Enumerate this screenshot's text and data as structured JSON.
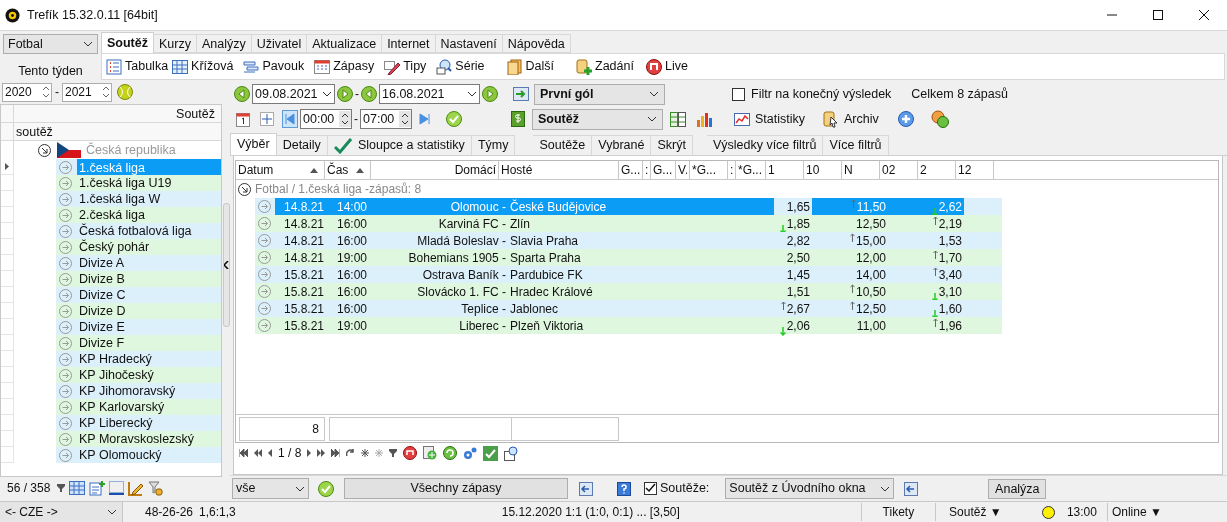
{
  "window": {
    "title": "Trefík 15.32.0.11 [64bit]"
  },
  "sport_select": {
    "value": "Fotbal"
  },
  "menu_tabs": [
    {
      "label": "Soutěž",
      "selected": true
    },
    {
      "label": "Kurzy",
      "selected": false
    },
    {
      "label": "Analýzy",
      "selected": false
    },
    {
      "label": "Uživatel",
      "selected": false
    },
    {
      "label": "Aktualizace",
      "selected": false
    },
    {
      "label": "Internet",
      "selected": false
    },
    {
      "label": "Nastavení",
      "selected": false
    },
    {
      "label": "Nápověda",
      "selected": false
    }
  ],
  "toolbar": [
    "Tabulka",
    "Křížová",
    "Pavouk",
    "Zápasy",
    "Tipy",
    "Série",
    "Další",
    "Zadání",
    "Live"
  ],
  "left_panel": {
    "period": "Tento týden",
    "year_from": "2020",
    "year_separator": "-",
    "year_to": "2021",
    "column_header": "Soutěž",
    "filter": "soutěž",
    "country": {
      "label": "Česká republika",
      "expanded": true
    },
    "items": [
      {
        "label": "1.česká liga",
        "selected": true
      },
      {
        "label": "1.česká liga U19",
        "selected": false
      },
      {
        "label": "1.česká liga W",
        "selected": false
      },
      {
        "label": "2.česká liga",
        "selected": false
      },
      {
        "label": "Česká fotbalová liga",
        "selected": false
      },
      {
        "label": "Český pohár",
        "selected": false
      },
      {
        "label": "Divize A",
        "selected": false
      },
      {
        "label": "Divize B",
        "selected": false
      },
      {
        "label": "Divize C",
        "selected": false
      },
      {
        "label": "Divize D",
        "selected": false
      },
      {
        "label": "Divize E",
        "selected": false
      },
      {
        "label": "Divize F",
        "selected": false
      },
      {
        "label": "KP Hradecký",
        "selected": false
      },
      {
        "label": "KP Jihočeský",
        "selected": false
      },
      {
        "label": "KP Jihomoravský",
        "selected": false
      },
      {
        "label": "KP Karlovarský",
        "selected": false
      },
      {
        "label": "KP Liberecký",
        "selected": false
      },
      {
        "label": "KP Moravskoslezský",
        "selected": false
      },
      {
        "label": "KP Olomoucký",
        "selected": false
      }
    ],
    "count": "56 / 358"
  },
  "filters": {
    "date_from": "09.08.2021",
    "date_separator": "-",
    "date_to": "16.08.2021",
    "event": "První gól",
    "final_result_filter": {
      "label": "Filtr na konečný výsledek",
      "checked": false
    },
    "total": "Celkem 8 zápasů",
    "time_from": "00:00",
    "time_separator": "-",
    "time_to": "07:00",
    "competition": "Soutěž",
    "statistics": "Statistiky",
    "archive": "Archiv"
  },
  "view_tabs": [
    {
      "label": "Výběr",
      "selected": true
    },
    {
      "label": "Detaily",
      "selected": false
    },
    {
      "label": "Sloupce a statistiky",
      "selected": false
    },
    {
      "label": "Týmy",
      "selected": false
    },
    {
      "label": "Soutěže",
      "selected": false
    },
    {
      "label": "Vybrané",
      "selected": false
    },
    {
      "label": "Skrýt",
      "selected": false
    },
    {
      "label": "Výsledky více filtrů",
      "selected": false
    },
    {
      "label": "Více filtrů",
      "selected": false
    }
  ],
  "grid": {
    "columns": [
      {
        "label": "Datum",
        "sorted": true
      },
      {
        "label": "Čas",
        "sorted": true
      },
      {
        "label": "Domácí",
        "sorted": false
      },
      {
        "label": "Hosté",
        "sorted": false
      },
      {
        "label": "G...",
        "sorted": false
      },
      {
        "label": ":",
        "sorted": false
      },
      {
        "label": "G...",
        "sorted": false
      },
      {
        "label": "V.",
        "sorted": false
      },
      {
        "label": "*G...",
        "sorted": false
      },
      {
        "label": ":",
        "sorted": false
      },
      {
        "label": "*G...",
        "sorted": false
      },
      {
        "label": "1",
        "sorted": false
      },
      {
        "label": "10",
        "sorted": false
      },
      {
        "label": "N",
        "sorted": false
      },
      {
        "label": "02",
        "sorted": false
      },
      {
        "label": "2",
        "sorted": false
      },
      {
        "label": "12",
        "sorted": false
      }
    ],
    "group": "Fotbal / 1.česká liga -zápasů: 8",
    "rows": [
      {
        "date": "14.8.21",
        "time": "14:00",
        "home": "Olomouc -",
        "away": "České Budějovice",
        "selected": true,
        "odds_1": {
          "value": "1,65",
          "up": false,
          "down": false
        },
        "odds_n": {
          "value": "11,50",
          "up": true,
          "down": false
        },
        "odds_2": {
          "value": "2,62",
          "up": false,
          "down": true
        }
      },
      {
        "date": "14.8.21",
        "time": "16:00",
        "home": "Karviná FC -",
        "away": "Zlín",
        "selected": false,
        "odds_1": {
          "value": "1,85",
          "up": false,
          "down": true
        },
        "odds_n": {
          "value": "12,50",
          "up": false,
          "down": false
        },
        "odds_2": {
          "value": "2,19",
          "up": true,
          "down": false
        }
      },
      {
        "date": "14.8.21",
        "time": "16:00",
        "home": "Mladá Boleslav -",
        "away": "Slavia Praha",
        "selected": false,
        "odds_1": {
          "value": "2,82",
          "up": false,
          "down": false
        },
        "odds_n": {
          "value": "15,00",
          "up": true,
          "down": false
        },
        "odds_2": {
          "value": "1,53",
          "up": false,
          "down": false
        }
      },
      {
        "date": "14.8.21",
        "time": "19:00",
        "home": "Bohemians 1905 -",
        "away": "Sparta Praha",
        "selected": false,
        "odds_1": {
          "value": "2,50",
          "up": false,
          "down": false
        },
        "odds_n": {
          "value": "12,00",
          "up": false,
          "down": false
        },
        "odds_2": {
          "value": "1,70",
          "up": true,
          "down": false
        }
      },
      {
        "date": "15.8.21",
        "time": "16:00",
        "home": "Ostrava Baník -",
        "away": "Pardubice FK",
        "selected": false,
        "odds_1": {
          "value": "1,45",
          "up": false,
          "down": false
        },
        "odds_n": {
          "value": "14,00",
          "up": false,
          "down": false
        },
        "odds_2": {
          "value": "3,40",
          "up": true,
          "down": false
        }
      },
      {
        "date": "15.8.21",
        "time": "16:00",
        "home": "Slovácko 1. FC -",
        "away": "Hradec Králové",
        "selected": false,
        "odds_1": {
          "value": "1,51",
          "up": false,
          "down": false
        },
        "odds_n": {
          "value": "10,50",
          "up": true,
          "down": false
        },
        "odds_2": {
          "value": "3,10",
          "up": false,
          "down": true
        }
      },
      {
        "date": "15.8.21",
        "time": "16:00",
        "home": "Teplice -",
        "away": "Jablonec",
        "selected": false,
        "odds_1": {
          "value": "2,67",
          "up": true,
          "down": false
        },
        "odds_n": {
          "value": "12,50",
          "up": true,
          "down": false
        },
        "odds_2": {
          "value": "1,60",
          "up": false,
          "down": true
        }
      },
      {
        "date": "15.8.21",
        "time": "19:00",
        "home": "Liberec -",
        "away": "Plzeň Viktoria",
        "selected": false,
        "odds_1": {
          "value": "2,06",
          "up": false,
          "down": true
        },
        "odds_n": {
          "value": "11,00",
          "up": false,
          "down": false
        },
        "odds_2": {
          "value": "1,96",
          "up": true,
          "down": false
        }
      }
    ],
    "footer_count": "8",
    "pager": "1 / 8"
  },
  "bottom_bar": {
    "filter": "vše",
    "all_matches": "Všechny zápasy",
    "competitions_checkbox": {
      "label": "Soutěže:",
      "checked": true
    },
    "competition_source": "Soutěž z Úvodního okna",
    "analysis": "Analýza"
  },
  "status_bar": {
    "country": "<- CZE ->",
    "stats": "48-26-26",
    "ratio": "1,6:1,3",
    "last_result": "15.12.2020 1:1 (1:0, 0:1) ... [3,50]",
    "tickets": "Tikety",
    "competition": "Soutěž ▼",
    "time": "13:00",
    "online": "Online ▼"
  }
}
